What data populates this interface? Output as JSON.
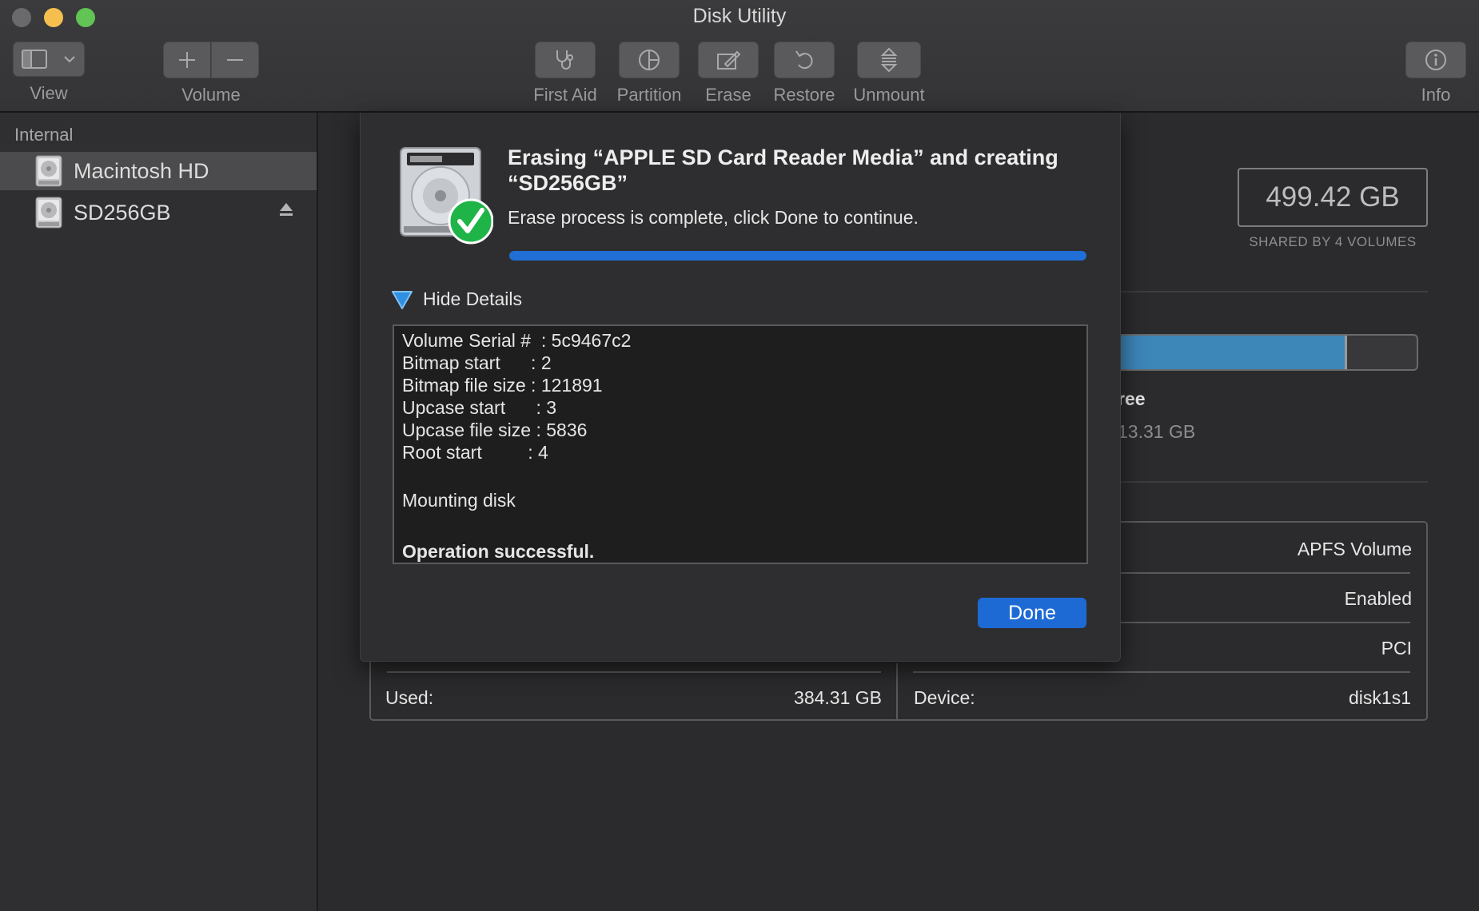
{
  "window": {
    "title": "Disk Utility"
  },
  "toolbar": {
    "view_label": "View",
    "volume_label": "Volume",
    "first_aid_label": "First Aid",
    "partition_label": "Partition",
    "erase_label": "Erase",
    "restore_label": "Restore",
    "unmount_label": "Unmount",
    "info_label": "Info"
  },
  "sidebar": {
    "section_header": "Internal",
    "items": [
      {
        "label": "Macintosh HD",
        "selected": true
      },
      {
        "label": "SD256GB",
        "selected": false,
        "eject": true
      }
    ]
  },
  "volume_info": {
    "capacity": "499.42 GB",
    "capacity_caption": "SHARED BY 4 VOLUMES",
    "usage_fraction": 0.77,
    "free_label_partial": "ree",
    "free_value_partial": "13.31 GB",
    "type_value": "APFS Volume",
    "enabled_value": "Enabled",
    "connection_value": "PCI",
    "used_label": "Used:",
    "used_value": "384.31 GB",
    "device_label": "Device:",
    "device_value": "disk1s1"
  },
  "dialog": {
    "title": "Erasing “APPLE SD Card Reader Media” and creating “SD256GB”",
    "message": "Erase process is complete, click Done to continue.",
    "progress_percent": 100,
    "details_toggle_label": "Hide Details",
    "log": [
      "Volume Serial #  : 5c9467c2",
      "Bitmap start      : 2",
      "Bitmap file size : 121891",
      "Upcase start      : 3",
      "Upcase file size : 5836",
      "Root start         : 4"
    ],
    "log_mounting": "Mounting disk",
    "log_result": "Operation successful.",
    "done_label": "Done"
  },
  "colors": {
    "accent": "#1e6ad4",
    "success": "#1fb447",
    "usage_fill": "#3d86b8"
  }
}
